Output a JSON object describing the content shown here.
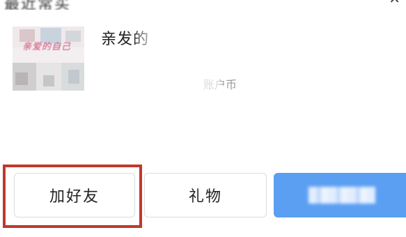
{
  "header": {
    "title_fragment": "最近常买",
    "close_glyph": "✕"
  },
  "item": {
    "thumbnail_caption": "亲爱的自己",
    "title": "亲发的",
    "meta": "",
    "subtext": "账户币"
  },
  "actions": {
    "add_friend_label": "加好友",
    "gift_label": "礼物",
    "primary_label": ""
  },
  "colors": {
    "primary_button": "#5b9ff3",
    "highlight_border": "#c0392b"
  }
}
